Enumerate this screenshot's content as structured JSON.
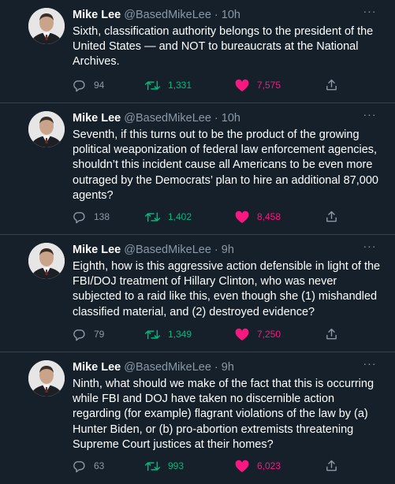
{
  "tweets": [
    {
      "name": "Mike Lee",
      "handle": "@BasedMikeLee",
      "time": "10h",
      "text": "Sixth, classification authority belongs to the president of the United States — and NOT to bureaucrats at the National Archives.",
      "replies": "94",
      "retweets": "1,331",
      "likes": "7,575"
    },
    {
      "name": "Mike Lee",
      "handle": "@BasedMikeLee",
      "time": "10h",
      "text": "Seventh, if this turns out to be the product of the growing political weaponization of federal law enforcement agencies, shouldn’t this incident cause all Americans to be even more outraged by the Democrats’ plan to hire an additional 87,000 agents?",
      "replies": "138",
      "retweets": "1,402",
      "likes": "8,458"
    },
    {
      "name": "Mike Lee",
      "handle": "@BasedMikeLee",
      "time": "9h",
      "text": "Eighth, how is this aggressive action defensible in light of the FBI/DOJ treatment of Hillary Clinton, who was never subjected to a raid like this, even though she (1) mishandled classified material, and (2) destroyed evidence?",
      "replies": "79",
      "retweets": "1,349",
      "likes": "7,250"
    },
    {
      "name": "Mike Lee",
      "handle": "@BasedMikeLee",
      "time": "9h",
      "text": "Ninth, what should we make of the fact that this is occurring while FBI and DOJ have taken no discernible action regarding (for example) flagrant violations of the law by (a) Hunter Biden, or (b) pro-abortion extremists threatening Supreme Court justices at their homes?",
      "replies": "63",
      "retweets": "993",
      "likes": "6,023"
    }
  ],
  "colors": {
    "background": "#15202b",
    "muted": "#8b98a5",
    "retweet": "#00ba7c",
    "like": "#f91880",
    "divider": "#38444d"
  },
  "icons": {
    "reply": "reply-icon",
    "retweet": "retweet-icon",
    "like": "heart-filled-icon",
    "share": "share-icon",
    "more": "more-icon"
  }
}
